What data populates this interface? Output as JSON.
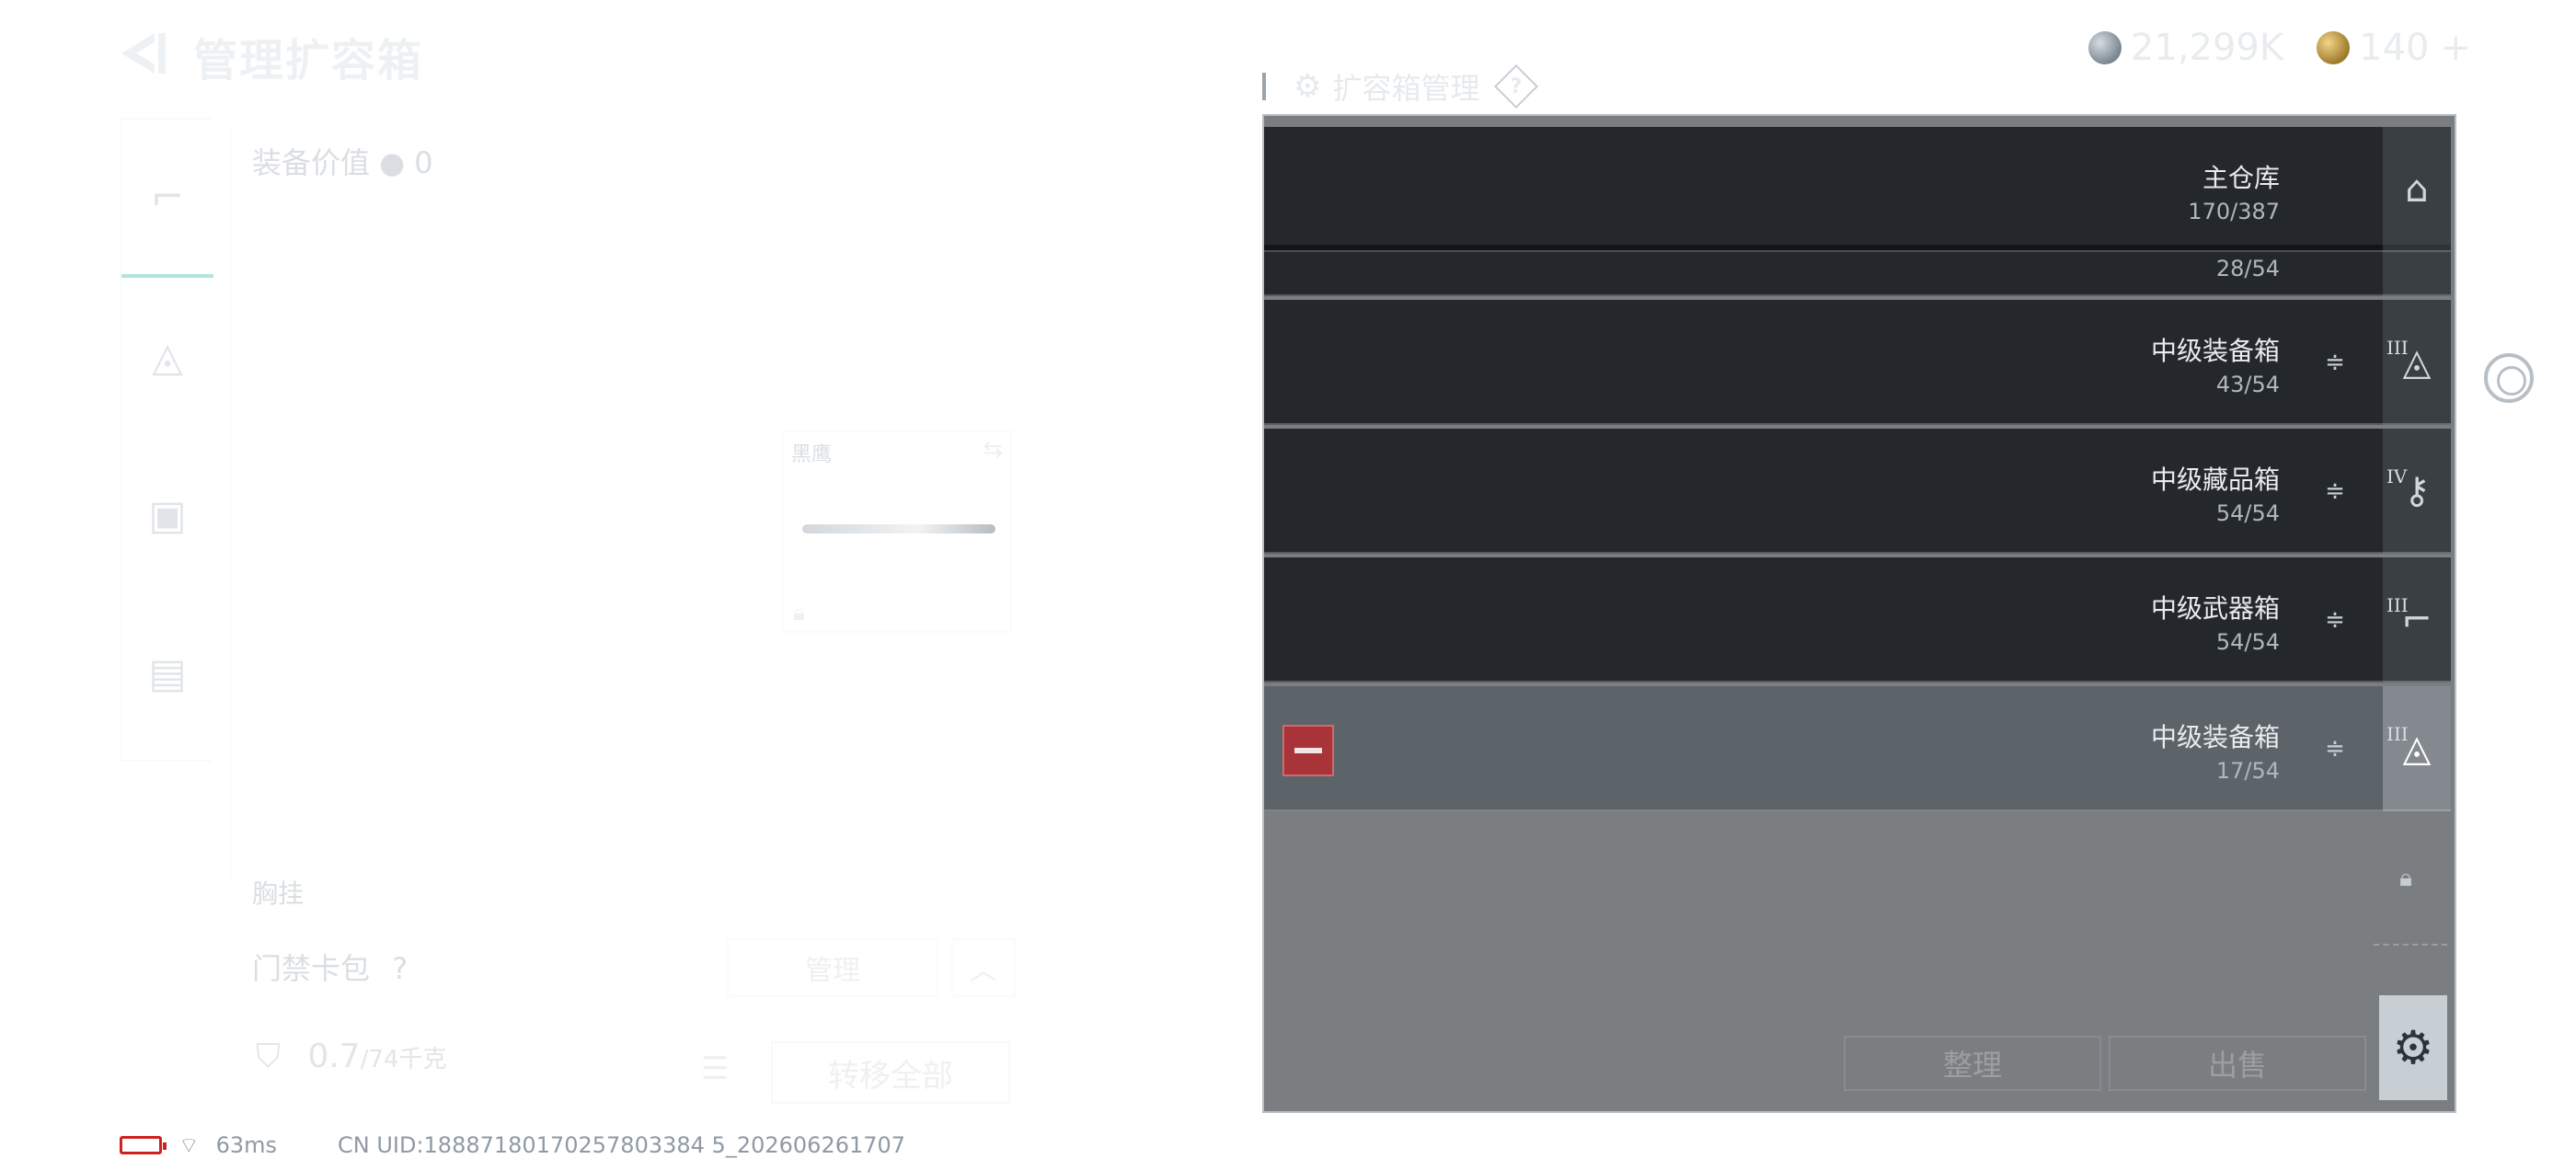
{
  "header": {
    "title": "管理扩容箱"
  },
  "currency": {
    "silver": "21,299K",
    "gold": "140",
    "plus": "+"
  },
  "left": {
    "equip_value_label": "装备价值",
    "equip_value": "0",
    "melee_label": "黑鹰",
    "chest_label": "胸挂",
    "keycard_label": "门禁卡包",
    "keycard_help": "?",
    "keycard_manage": "管理",
    "weight_value": "0.7",
    "weight_max": "/74千克",
    "transfer_all": "转移全部"
  },
  "status": {
    "ping": "63ms",
    "uid": "CN UID:18887180170257803384 5_202606261707"
  },
  "manager": {
    "title": "扩容箱管理",
    "help": "?",
    "rows": [
      {
        "name": "主仓库",
        "capacity": "170/387",
        "tier": ""
      },
      {
        "name": "",
        "capacity": "28/54",
        "tier": ""
      },
      {
        "name": "中级装备箱",
        "capacity": "43/54",
        "tier": "III"
      },
      {
        "name": "中级藏品箱",
        "capacity": "54/54",
        "tier": "IV"
      },
      {
        "name": "中级武器箱",
        "capacity": "54/54",
        "tier": "III"
      },
      {
        "name": "中级装备箱",
        "capacity": "17/54",
        "tier": "III"
      }
    ],
    "buttons": {
      "organize": "整理",
      "sell": "出售"
    }
  }
}
